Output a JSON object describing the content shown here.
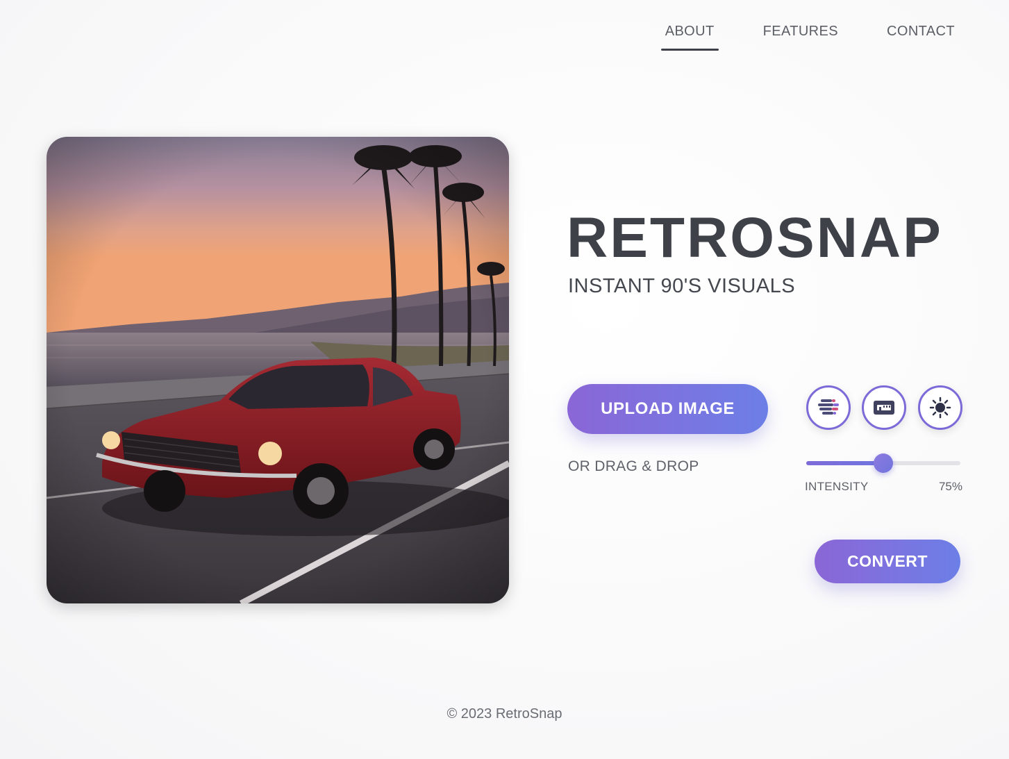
{
  "nav": {
    "items": [
      {
        "label": "ABOUT",
        "active": true
      },
      {
        "label": "FEATURES",
        "active": false
      },
      {
        "label": "CONTACT",
        "active": false
      }
    ]
  },
  "hero": {
    "title": "RETROSNAP",
    "subtitle": "INSTANT 90'S VISUALS"
  },
  "preview": {
    "description": "retro red muscle car on coastal road at sunset with palm trees"
  },
  "upload": {
    "button_label": "UPLOAD IMAGE",
    "hint": "OR DRAG & DROP"
  },
  "filters": [
    {
      "icon": "vhs-lines-icon",
      "name": "VHS"
    },
    {
      "icon": "film-frame-icon",
      "name": "Film"
    },
    {
      "icon": "sun-icon",
      "name": "Brightness"
    }
  ],
  "intensity": {
    "label": "INTENSITY",
    "value_text": "75%",
    "value": 0.5
  },
  "convert": {
    "button_label": "CONVERT"
  },
  "footer": {
    "text": "© 2023 RetroSnap"
  },
  "colors": {
    "accent_start": "#8a66d6",
    "accent_end": "#6c7fe6",
    "text_dark": "#3f4149"
  }
}
